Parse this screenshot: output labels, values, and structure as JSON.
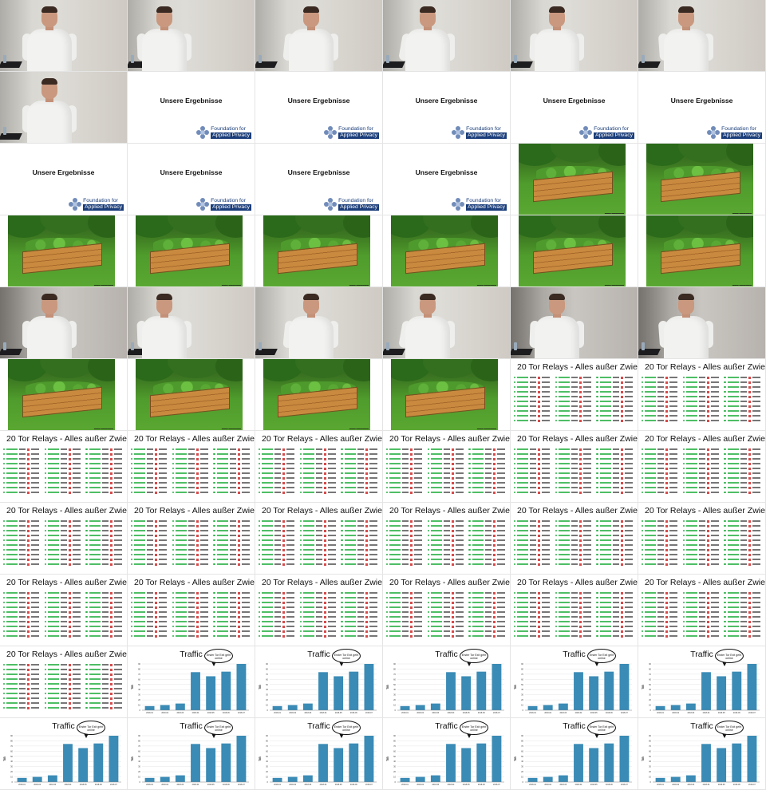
{
  "frames": [
    "speaker",
    "speaker",
    "speaker",
    "speaker",
    "speaker",
    "speaker",
    "speaker",
    "title",
    "title",
    "title",
    "title",
    "title",
    "title",
    "title",
    "title",
    "title",
    "garden",
    "garden",
    "garden",
    "garden",
    "garden",
    "garden",
    "garden",
    "garden",
    "speaker-dark",
    "speaker",
    "speaker",
    "speaker",
    "speaker-dark",
    "speaker-dark",
    "garden",
    "garden",
    "garden",
    "garden",
    "relays",
    "relays",
    "relays",
    "relays",
    "relays",
    "relays",
    "relays",
    "relays",
    "relays",
    "relays",
    "relays",
    "relays",
    "relays",
    "relays",
    "relays",
    "relays",
    "relays",
    "relays",
    "relays",
    "relays",
    "relays",
    "traffic",
    "traffic",
    "traffic",
    "traffic",
    "traffic",
    "traffic",
    "traffic",
    "traffic",
    "traffic",
    "traffic",
    "traffic"
  ],
  "title_slide": {
    "title": "Unsere Ergebnisse",
    "logo_line1": "Foundation for",
    "logo_line2": "Applied Privacy"
  },
  "relays_slide": {
    "title": "20 Tor Relays - Alles außer Zwiebel",
    "rows_per_column": 10,
    "status_color": "#2fb34a",
    "flag_color": "#d84a4a"
  },
  "traffic_slide": {
    "title": "Traffic",
    "bubble_text": "Erster Tor Exit geht online",
    "bar_color": "#3a8bb5"
  },
  "chart_data": {
    "type": "bar",
    "title": "Traffic",
    "ylabel": "TiB",
    "categories": [
      "2018-01",
      "2018-02",
      "2018-03",
      "2018-04",
      "2018-05",
      "2018-06",
      "2018-07"
    ],
    "values": [
      8,
      10,
      13,
      74,
      66,
      75,
      90
    ],
    "ylim": [
      0,
      90
    ]
  }
}
